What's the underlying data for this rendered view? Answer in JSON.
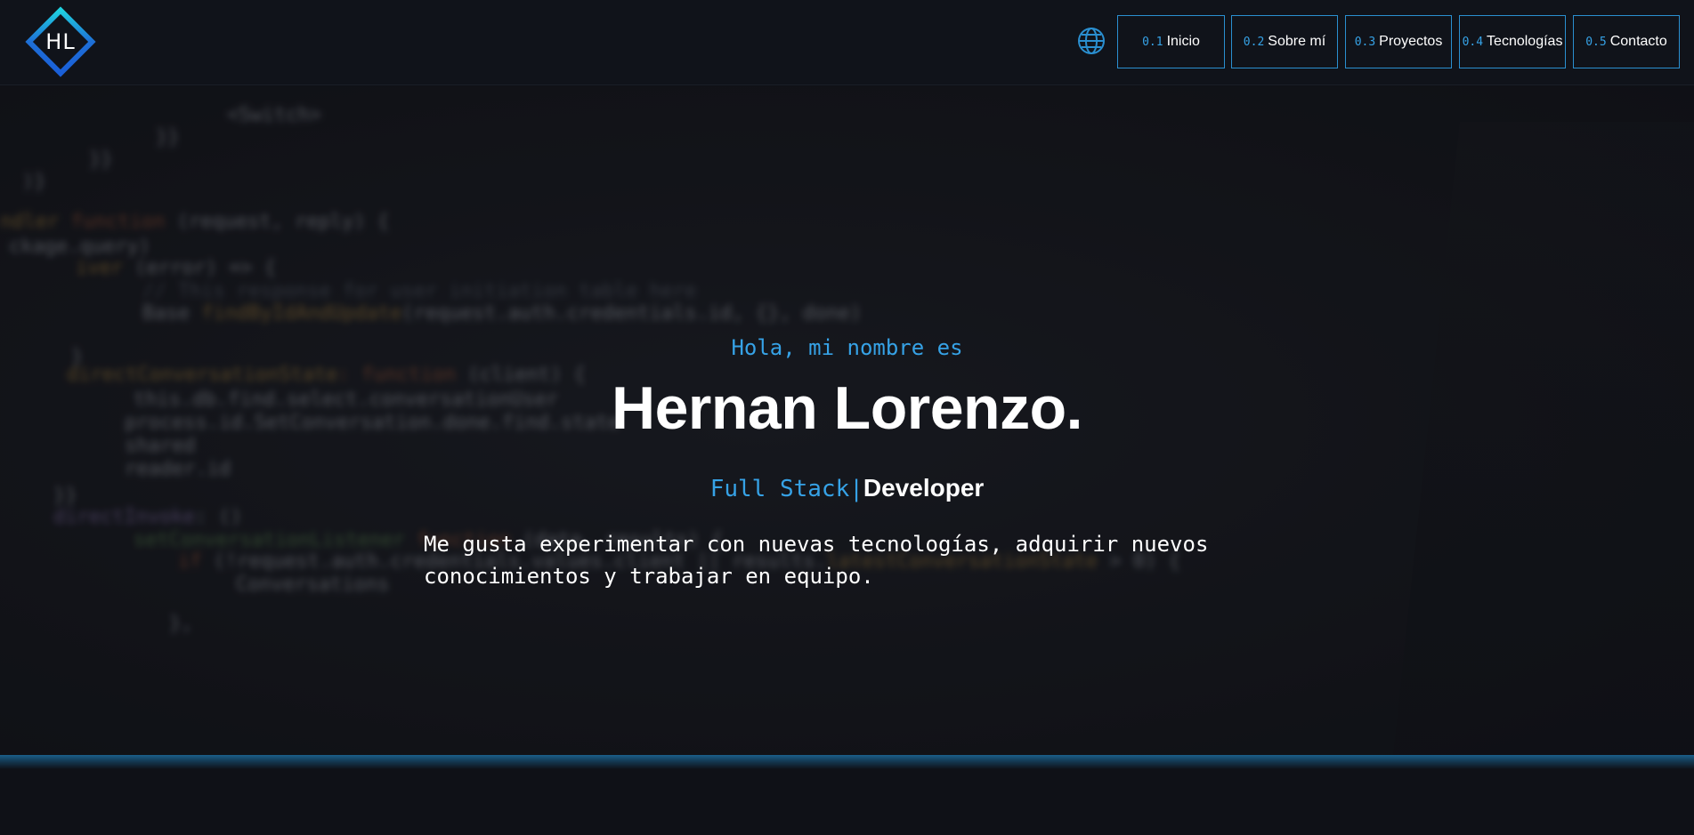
{
  "brand": {
    "logo_text": "HL"
  },
  "colors": {
    "accent": "#36a2e6",
    "background": "#0f1117",
    "text": "#ffffff"
  },
  "header": {
    "language_icon": "globe-icon",
    "nav": [
      {
        "num": "0.1",
        "label": "Inicio"
      },
      {
        "num": "0.2",
        "label": "Sobre mí"
      },
      {
        "num": "0.3",
        "label": "Proyectos"
      },
      {
        "num": "0.4",
        "label": "Tecnologías"
      },
      {
        "num": "0.5",
        "label": "Contacto"
      }
    ]
  },
  "hero": {
    "greeting": "Hola, mi nombre es",
    "name": "Hernan Lorenzo.",
    "role_prefix": "Full Stack",
    "role_cursor": "|",
    "role_main": "Developer",
    "bio_line1": "Me gusta experimentar con nuevas tecnologías, adquirir nuevos",
    "bio_line2": "conocimientos y trabajar en equipo."
  }
}
